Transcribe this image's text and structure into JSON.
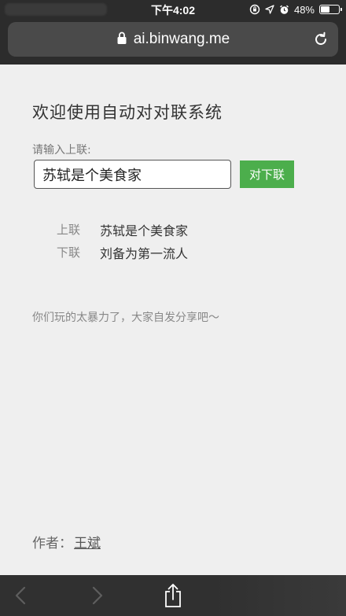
{
  "status_bar": {
    "time": "下午4:02",
    "battery_percent": "48%",
    "battery_level": 0.48
  },
  "browser": {
    "url": "ai.binwang.me"
  },
  "page": {
    "title": "欢迎使用自动对对联系统",
    "input_label": "请输入上联:",
    "input_value": "苏轼是个美食家",
    "submit_label": "对下联",
    "result": {
      "upper_key": "上联",
      "upper_value": "苏轼是个美食家",
      "lower_key": "下联",
      "lower_value": "刘备为第一流人"
    },
    "note": "你们玩的太暴力了，大家自发分享吧～",
    "author_label": "作者：",
    "author_name": "王斌"
  },
  "toolbar": {
    "icons": [
      "back-icon",
      "forward-icon",
      "share-icon"
    ]
  },
  "colors": {
    "chrome": "#2c2c2c",
    "address_bar": "#4a4a4a",
    "page_bg": "#efefef",
    "button_green": "#4cae4c"
  }
}
